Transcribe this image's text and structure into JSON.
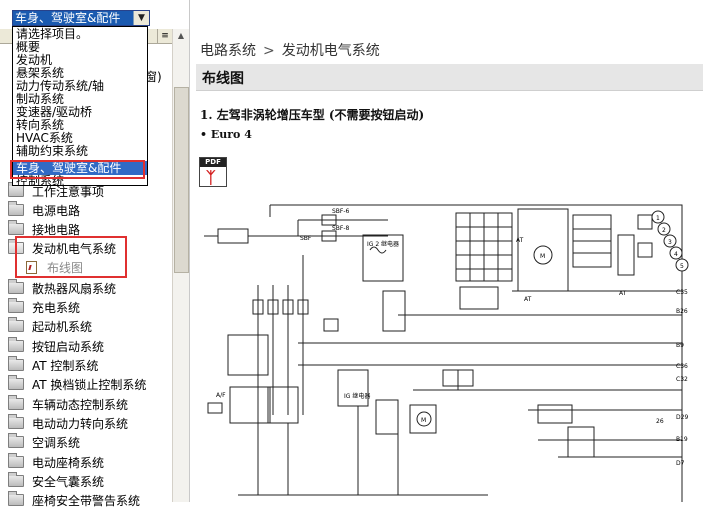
{
  "category_select": {
    "value": "车身、驾驶室&配件",
    "arrow": "▼"
  },
  "dropdown": {
    "options": [
      "请选择项目。",
      "概要",
      "发动机",
      "悬架系统",
      "动力传动系统/轴",
      "制动系统",
      "变速器/驱动桥",
      "转向系统",
      "HVAC系统",
      "辅助约束系统",
      "车身、驾驶室&配件",
      "控制系统"
    ],
    "selected_index": 10
  },
  "tree": {
    "partial_text": "窗)",
    "items": [
      "工作注意事项",
      "电源电路",
      "接地电路",
      "发动机电气系统",
      "布线图",
      "散热器风扇系统",
      "充电系统",
      "起动机系统",
      "按钮启动系统",
      "AT 控制系统",
      "AT 换档锁止控制系统",
      "车辆动态控制系统",
      "电动动力转向系统",
      "空调系统",
      "电动座椅系统",
      "安全气囊系统",
      "座椅安全带警告系统"
    ]
  },
  "breadcrumb": {
    "parent": "电路系统",
    "separator": ">",
    "current": "发动机电气系统"
  },
  "section": {
    "title": "布线图"
  },
  "diagram": {
    "heading": "1.  左驾非涡轮增压车型 (不需要按钮启动)",
    "variant": "• Euro 4",
    "pdf_label": "PDF",
    "labels": {
      "sbf6": "SBF-6",
      "sbf8": "SBF-8",
      "sbf": "SBF",
      "ig2": "IG 2 继电器",
      "ig": "IG 继电器",
      "at": "AT",
      "m": "M",
      "c35": "C35",
      "b26": "B26",
      "b9": "B9",
      "c36": "C36",
      "c32": "C32",
      "d29": "D29",
      "n26": "26",
      "b19": "B19",
      "d7": "D7",
      "af": "A/F",
      "c1": "1",
      "c2": "2",
      "c3": "3",
      "c4": "4",
      "c5": "5"
    }
  }
}
